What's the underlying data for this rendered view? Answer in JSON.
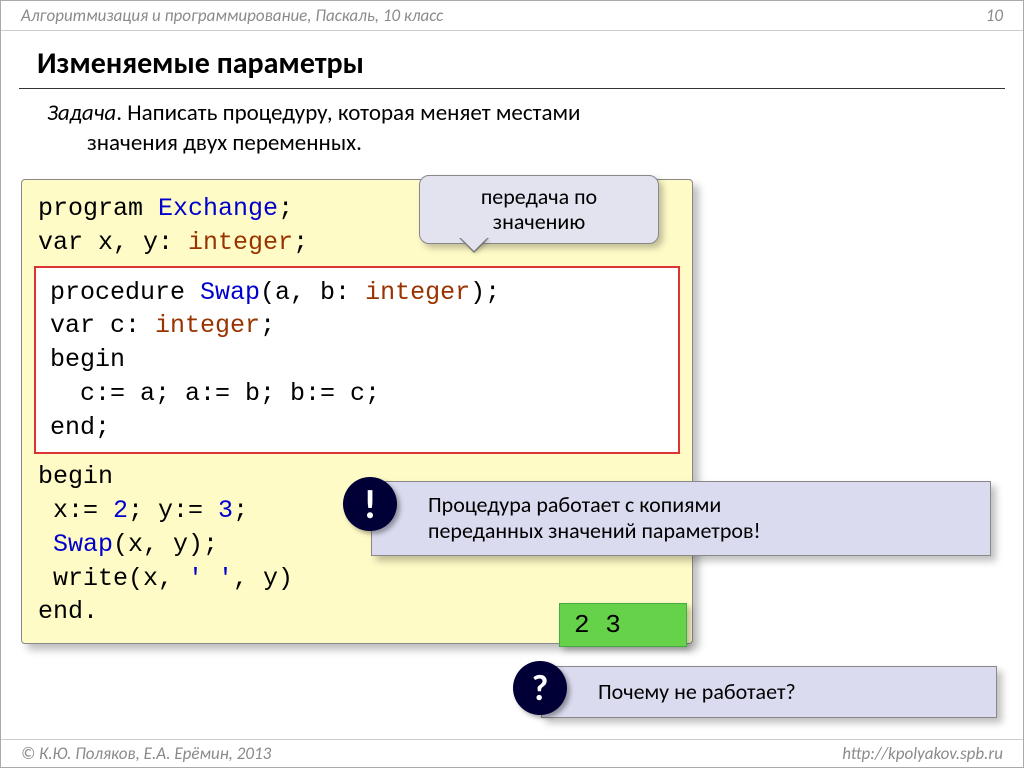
{
  "header": {
    "breadcrumb": "Алгоритмизация и программирование, Паскаль, 10 класс",
    "page_number": "10"
  },
  "title": "Изменяемые параметры",
  "task": {
    "label": "Задача",
    "text_line1": ". Написать процедуру, которая меняет местами",
    "text_line2": "значения двух переменных."
  },
  "code": {
    "l1_a": "program ",
    "l1_b": "Exchange",
    "l1_c": ";",
    "l2_a": "var x, y: ",
    "l2_b": "integer",
    "l2_c": ";",
    "p1_a": "procedure ",
    "p1_b": "Swap",
    "p1_c": "(a, b: ",
    "p1_d": "integer",
    "p1_e": ");",
    "p2_a": "var c: ",
    "p2_b": "integer",
    "p2_c": ";",
    "p3": "begin",
    "p4": "  c:= a; a:= b; b:= c;",
    "p5": "end;",
    "m1": "begin",
    "m2_a": " x:= ",
    "m2_b": "2",
    "m2_c": "; y:= ",
    "m2_d": "3",
    "m2_e": ";",
    "m3_a": " ",
    "m3_b": "Swap",
    "m3_c": "(x, y);",
    "m4_a": " write(x, ",
    "m4_b": "' '",
    "m4_c": ", y)",
    "m5": "end."
  },
  "bubble": {
    "line1": "передача по",
    "line2": "значению"
  },
  "note1": {
    "icon": "!",
    "line1": "Процедура работает с копиями",
    "line2": "переданных значений параметров!"
  },
  "output": "2 3",
  "note2": {
    "icon": "?",
    "text": "Почему не работает?"
  },
  "footer": {
    "left": "© К.Ю. Поляков, Е.А. Ерёмин, 2013",
    "right": "http://kpolyakov.spb.ru"
  }
}
